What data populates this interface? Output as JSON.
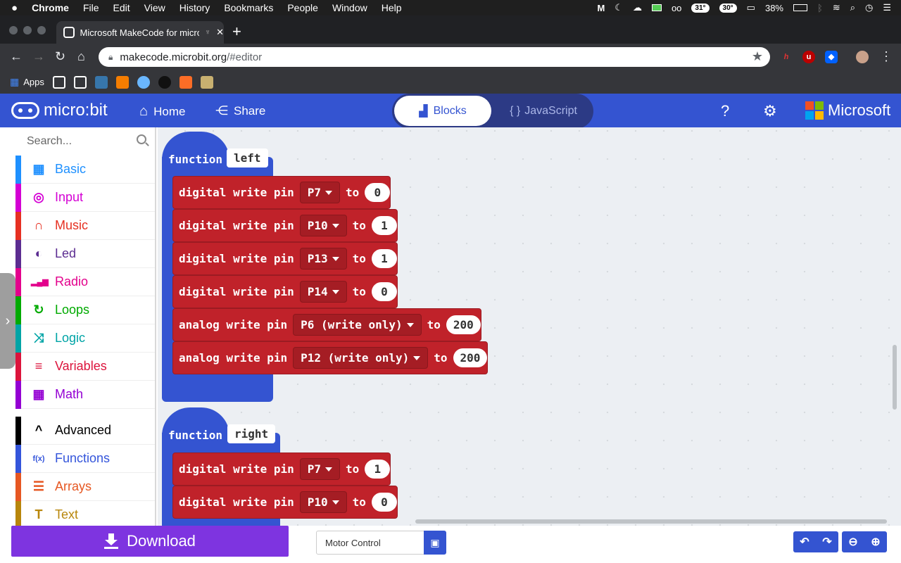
{
  "macos_menu": {
    "app_name": "Chrome",
    "items": [
      "File",
      "Edit",
      "View",
      "History",
      "Bookmarks",
      "People",
      "Window",
      "Help"
    ],
    "status": {
      "temp1": "31°",
      "temp2": "30°",
      "battery": "38%"
    }
  },
  "browser": {
    "tab_title": "Microsoft MakeCode for micro:bit",
    "url_host": "makecode.microbit.org",
    "url_path": "/#editor",
    "bookmarks_apps_label": "Apps"
  },
  "header": {
    "logo_text": "micro:bit",
    "home_label": "Home",
    "share_label": "Share",
    "blocks_label": "Blocks",
    "javascript_label": "JavaScript",
    "brand_label": "Microsoft"
  },
  "toolbox": {
    "search_placeholder": "Search...",
    "categories": [
      {
        "label": "Basic",
        "color": "#1e90ff",
        "icon": "grid-icon"
      },
      {
        "label": "Input",
        "color": "#d400d4",
        "icon": "target-icon"
      },
      {
        "label": "Music",
        "color": "#e63022",
        "icon": "headphones-icon"
      },
      {
        "label": "Led",
        "color": "#5c2d91",
        "icon": "toggle-icon"
      },
      {
        "label": "Radio",
        "color": "#e3008c",
        "icon": "signal-icon"
      },
      {
        "label": "Loops",
        "color": "#00aa00",
        "icon": "refresh-icon"
      },
      {
        "label": "Logic",
        "color": "#00a4a6",
        "icon": "shuffle-icon"
      },
      {
        "label": "Variables",
        "color": "#dc143c",
        "icon": "lines-icon"
      },
      {
        "label": "Math",
        "color": "#9400d3",
        "icon": "calculator-icon"
      },
      {
        "label": "Advanced",
        "color": "#000000",
        "icon": "chevron-up-icon"
      },
      {
        "label": "Functions",
        "color": "#3455db",
        "icon": "fx-icon"
      },
      {
        "label": "Arrays",
        "color": "#e65722",
        "icon": "list-icon"
      },
      {
        "label": "Text",
        "color": "#b8860b",
        "icon": "text-icon"
      }
    ]
  },
  "workspace": {
    "functions": [
      {
        "keyword": "function",
        "name": "left",
        "blocks": [
          {
            "text": "digital write pin",
            "pin": "P7",
            "to": "to",
            "value": "0"
          },
          {
            "text": "digital write pin",
            "pin": "P10",
            "to": "to",
            "value": "1"
          },
          {
            "text": "digital write pin",
            "pin": "P13",
            "to": "to",
            "value": "1"
          },
          {
            "text": "digital write pin",
            "pin": "P14",
            "to": "to",
            "value": "0"
          },
          {
            "text": "analog write pin",
            "pin": "P6 (write only)",
            "to": "to",
            "value": "200"
          },
          {
            "text": "analog write pin",
            "pin": "P12 (write only)",
            "to": "to",
            "value": "200"
          }
        ]
      },
      {
        "keyword": "function",
        "name": "right",
        "blocks": [
          {
            "text": "digital write pin",
            "pin": "P7",
            "to": "to",
            "value": "1"
          },
          {
            "text": "digital write pin",
            "pin": "P10",
            "to": "to",
            "value": "0"
          }
        ]
      }
    ]
  },
  "bottom": {
    "download_label": "Download",
    "project_name": "Motor Control"
  }
}
